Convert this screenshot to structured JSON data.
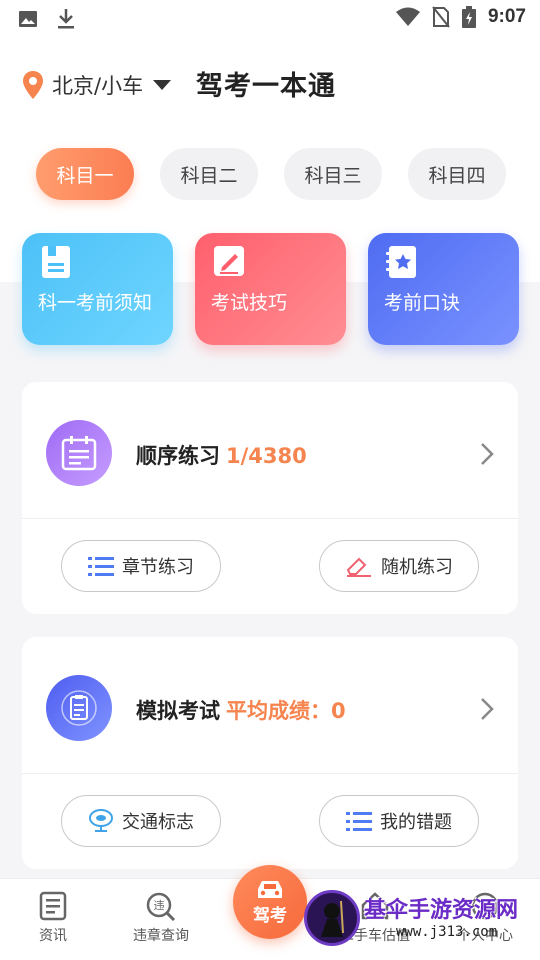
{
  "status_bar": {
    "time": "9:07"
  },
  "header": {
    "location": "北京/小车",
    "title": "驾考一本通"
  },
  "subject_tabs": [
    {
      "label": "科目一",
      "active": true
    },
    {
      "label": "科目二",
      "active": false
    },
    {
      "label": "科目三",
      "active": false
    },
    {
      "label": "科目四",
      "active": false
    }
  ],
  "quick_cards": [
    {
      "label": "科一考前须知",
      "icon": "document-icon",
      "color": "#4cc1f7"
    },
    {
      "label": "考试技巧",
      "icon": "pencil-note-icon",
      "color": "#ff5f6d"
    },
    {
      "label": "考前口诀",
      "icon": "star-notebook-icon",
      "color": "#4f6cf2"
    }
  ],
  "practice_card": {
    "title": "顺序练习",
    "value": "1/4380",
    "buttons": [
      {
        "label": "章节练习",
        "icon": "list-icon"
      },
      {
        "label": "随机练习",
        "icon": "eraser-icon"
      }
    ]
  },
  "exam_card": {
    "title": "模拟考试",
    "value": "平均成绩：0",
    "buttons": [
      {
        "label": "交通标志",
        "icon": "road-sign-icon"
      },
      {
        "label": "我的错题",
        "icon": "list-icon"
      }
    ]
  },
  "bottom_nav": {
    "items": [
      {
        "label": "资讯",
        "icon": "news-icon"
      },
      {
        "label": "违章查询",
        "icon": "violation-search-icon"
      },
      {
        "label": "驾考",
        "icon": "car-icon"
      },
      {
        "label": "二手车估值",
        "icon": "house-icon"
      },
      {
        "label": "个人中心",
        "icon": "person-icon"
      }
    ]
  },
  "watermark": {
    "title": "基伞手游资源网",
    "url": "www.j313.com"
  },
  "colors": {
    "accent_orange": "#f5844f",
    "tab_active": "#fb7d52",
    "blue_card": "#4cc1f7",
    "red_card": "#ff5f6d",
    "indigo_card": "#4f6cf2"
  }
}
